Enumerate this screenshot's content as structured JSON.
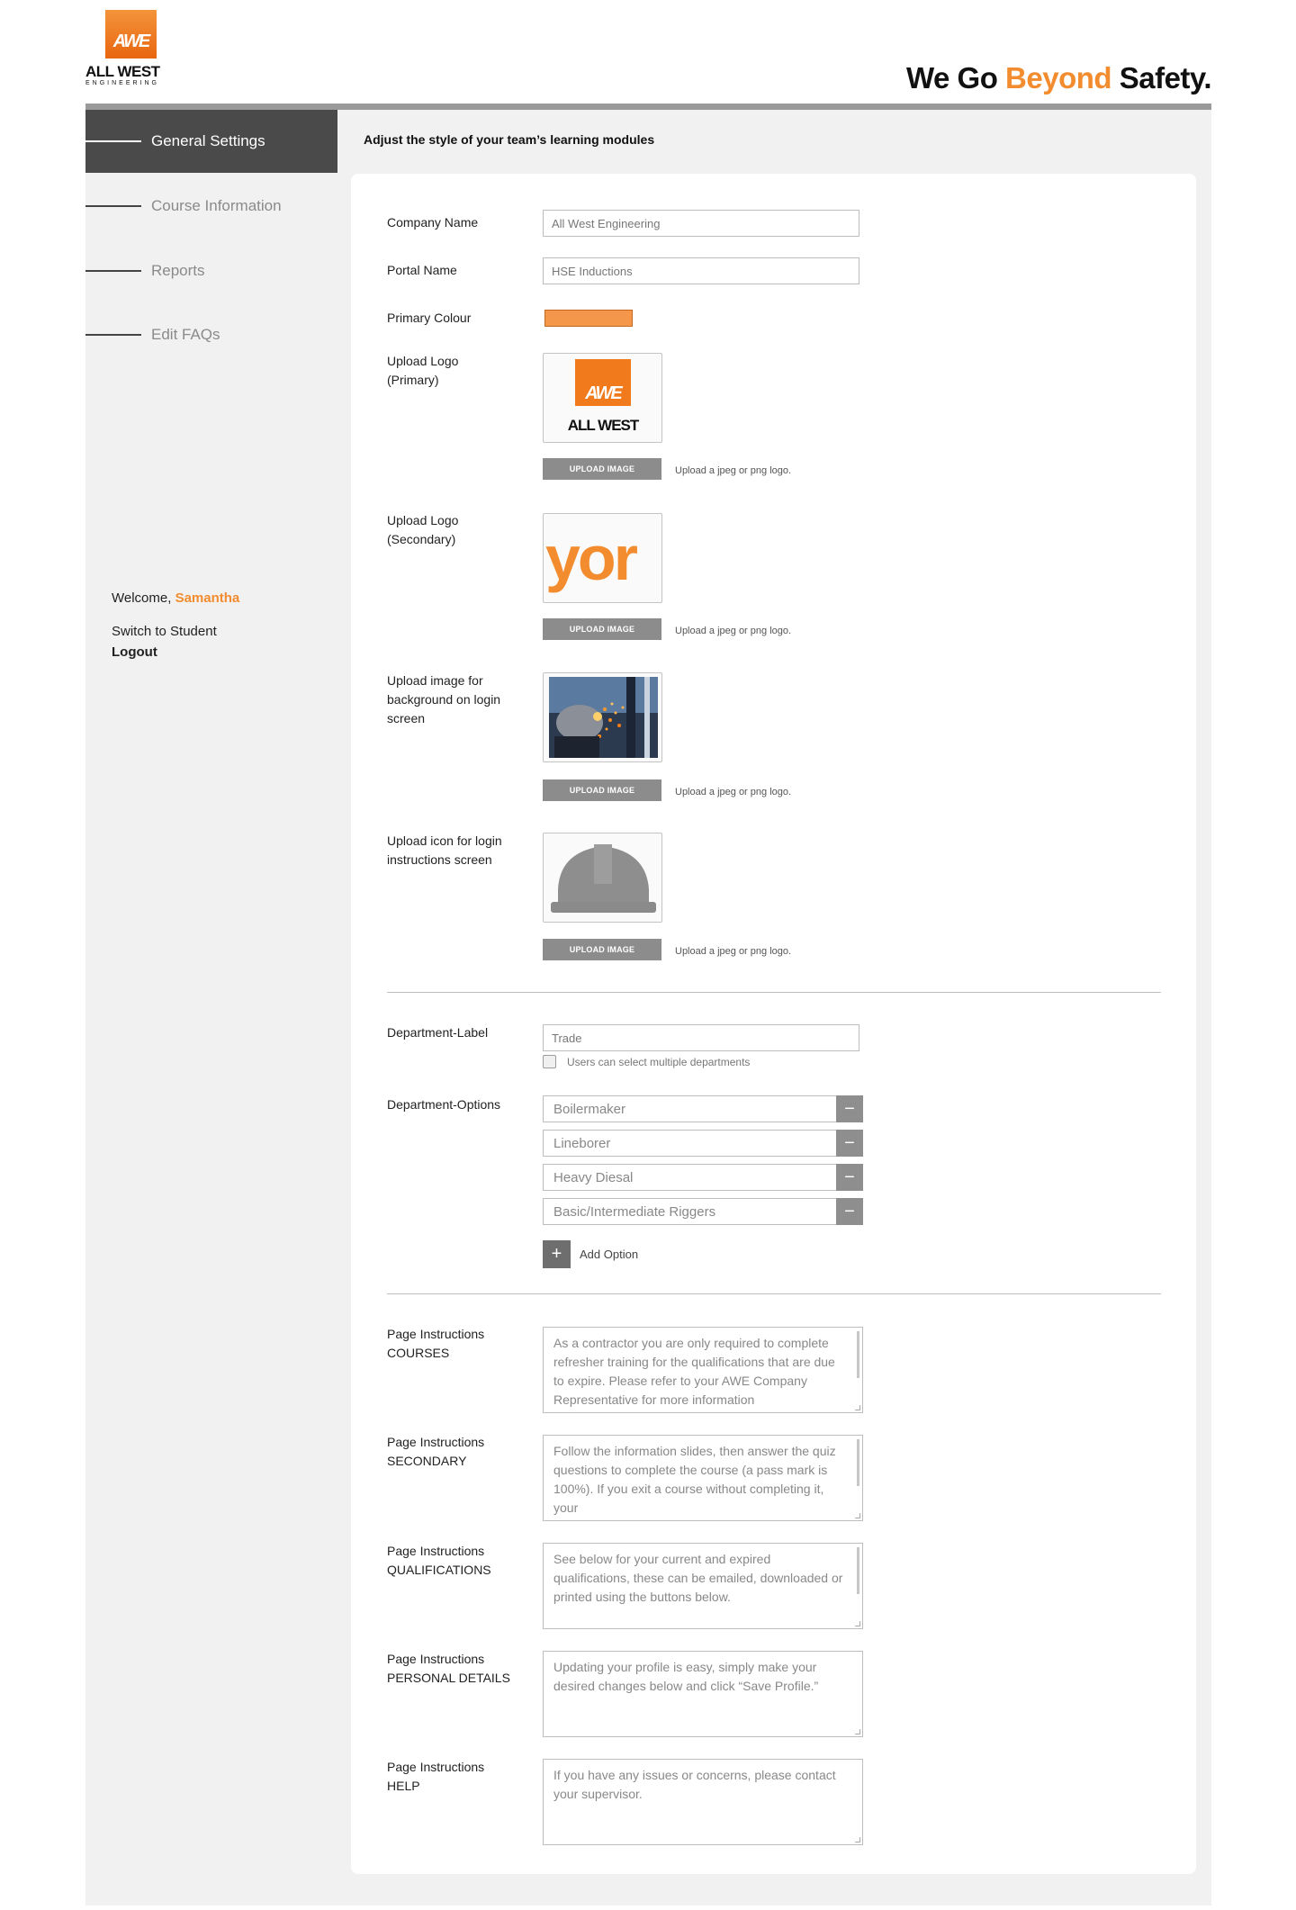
{
  "brand": {
    "logo_abbrev": "AWE",
    "logo_name": "ALL WEST",
    "logo_sub": "ENGINEERING",
    "tagline_pre": "We Go ",
    "tagline_accent": "Beyond",
    "tagline_post": " Safety.",
    "accent_color": "#f28c2e"
  },
  "sidebar": {
    "items": [
      {
        "label": "General Settings",
        "active": true
      },
      {
        "label": "Course Information",
        "active": false
      },
      {
        "label": "Reports",
        "active": false
      },
      {
        "label": "Edit FAQs",
        "active": false
      }
    ],
    "welcome_prefix": "Welcome, ",
    "user_name": "Samantha",
    "switch_label": "Switch to Student",
    "logout_label": "Logout"
  },
  "main": {
    "heading": "Adjust the style of your team’s learning modules",
    "company_name": {
      "label": "Company Name",
      "value": "All West Engineering"
    },
    "portal_name": {
      "label": "Portal Name",
      "value": "HSE Inductions"
    },
    "primary_colour": {
      "label": "Primary Colour",
      "value": "#f4974a"
    },
    "uploads": [
      {
        "label_line1": "Upload Logo",
        "label_line2": "(Primary)",
        "label_line3": "",
        "button": "UPLOAD IMAGE",
        "hint": "Upload a jpeg or png logo.",
        "preview": "awe-logo-icon"
      },
      {
        "label_line1": "Upload Logo",
        "label_line2": "(Secondary)",
        "label_line3": "",
        "button": "UPLOAD IMAGE",
        "hint": "Upload a jpeg or png logo.",
        "preview": "beyond-crop-icon",
        "preview_text": "yor"
      },
      {
        "label_line1": "Upload image for",
        "label_line2": "background on login",
        "label_line3": "screen",
        "button": "UPLOAD IMAGE",
        "hint": "Upload a jpeg or png logo.",
        "preview": "welding-photo"
      },
      {
        "label_line1": "Upload icon for login",
        "label_line2": "instructions screen",
        "label_line3": "",
        "button": "UPLOAD IMAGE",
        "hint": "Upload a jpeg or png logo.",
        "preview": "hard-hat-icon"
      }
    ],
    "department_label": {
      "label": "Department-Label",
      "placeholder": "Trade",
      "multi_select_label": "Users can select multiple departments",
      "multi_select_checked": false
    },
    "department_options": {
      "label": "Department-Options",
      "options": [
        "Boilermaker",
        "Lineborer",
        "Heavy Diesal",
        "Basic/Intermediate Riggers"
      ],
      "add_label": "Add Option"
    },
    "instructions": [
      {
        "label_line1": "Page Instructions",
        "label_line2": "COURSES",
        "text": "As a contractor you are only required to complete refresher training for the qualifications that are due to expire. Please refer to your AWE Company Representative for more information"
      },
      {
        "label_line1": "Page Instructions",
        "label_line2": "SECONDARY",
        "text": "Follow the information slides, then answer the quiz questions to complete the course (a pass mark is 100%). If you exit a course without completing it, your"
      },
      {
        "label_line1": "Page Instructions",
        "label_line2": "QUALIFICATIONS",
        "text": "See below for your current and expired qualifications, these can be emailed, downloaded or printed using the buttons below."
      },
      {
        "label_line1": "Page Instructions",
        "label_line2": "PERSONAL DETAILS",
        "text": "Updating your profile is easy, simply make your desired changes below and click “Save Profile.”"
      },
      {
        "label_line1": "Page Instructions",
        "label_line2": "HELP",
        "text": "If you have any issues or concerns, please contact your supervisor."
      }
    ]
  }
}
